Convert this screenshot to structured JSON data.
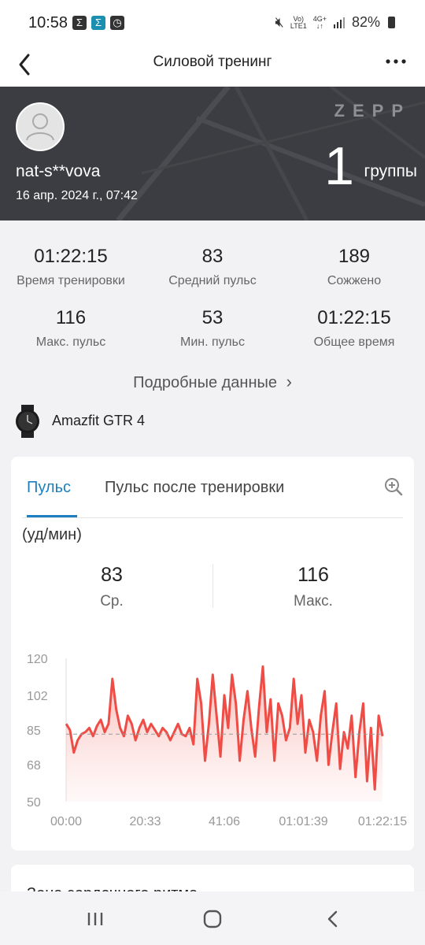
{
  "status_bar": {
    "time": "10:58",
    "battery": "82%",
    "network_top": "Vo)",
    "network_bottom": "LTE1",
    "net4g_top": "4G+",
    "net4g_bottom": "↓↑"
  },
  "app_bar": {
    "title": "Силовой тренинг"
  },
  "banner": {
    "username": "nat-s**vova",
    "datetime": "16 апр. 2024 г., 07:42",
    "brand": "ZEPP",
    "sets_value": "1",
    "sets_label": "группы"
  },
  "stats": [
    {
      "value": "01:22:15",
      "label": "Время тренировки"
    },
    {
      "value": "83",
      "label": "Средний пульс"
    },
    {
      "value": "189",
      "label": "Сожжено"
    },
    {
      "value": "116",
      "label": "Макс. пульс"
    },
    {
      "value": "53",
      "label": "Мин. пульс"
    },
    {
      "value": "01:22:15",
      "label": "Общее время"
    }
  ],
  "details_link": "Подробные данные",
  "device": {
    "name": "Amazfit GTR 4"
  },
  "hr_card": {
    "tabs": [
      "Пульс",
      "Пульс после тренировки"
    ],
    "unit": "(уд/мин)",
    "avg_value": "83",
    "avg_label": "Ср.",
    "max_value": "116",
    "max_label": "Макс."
  },
  "next_card": {
    "title": "Зона сердечного ритма"
  },
  "colors": {
    "accent": "#1c7fc2",
    "line": "#ee4c45",
    "banner": "#3b3d42"
  },
  "chart_data": {
    "type": "area",
    "x_ticks": [
      "00:00",
      "20:33",
      "41:06",
      "01:01:39",
      "01:22:15"
    ],
    "y_ticks": [
      120,
      102,
      85,
      68,
      50
    ],
    "ylim": [
      50,
      120
    ],
    "average": 83,
    "x_minutes": [
      0,
      1,
      2,
      3,
      4,
      5,
      6,
      7,
      8,
      9,
      10,
      11,
      12,
      13,
      14,
      15,
      16,
      17,
      18,
      19,
      20,
      21,
      22,
      23,
      24,
      25,
      26,
      27,
      28,
      29,
      30,
      31,
      32,
      33,
      34,
      35,
      36,
      37,
      38,
      39,
      40,
      41,
      42,
      43,
      44,
      45,
      46,
      47,
      48,
      49,
      50,
      51,
      52,
      53,
      54,
      55,
      56,
      57,
      58,
      59,
      60,
      61,
      62,
      63,
      64,
      65,
      66,
      67,
      68,
      69,
      70,
      71,
      72,
      73,
      74,
      75,
      76,
      77,
      78,
      79,
      80,
      81,
      82
    ],
    "values": [
      88,
      85,
      74,
      80,
      83,
      84,
      86,
      82,
      87,
      90,
      84,
      88,
      110,
      95,
      86,
      82,
      92,
      88,
      80,
      86,
      90,
      84,
      88,
      85,
      82,
      86,
      84,
      80,
      84,
      88,
      83,
      82,
      86,
      78,
      110,
      98,
      70,
      88,
      112,
      92,
      72,
      102,
      86,
      112,
      98,
      70,
      90,
      104,
      86,
      72,
      96,
      116,
      84,
      100,
      70,
      98,
      92,
      80,
      86,
      110,
      88,
      102,
      74,
      90,
      84,
      70,
      92,
      104,
      68,
      84,
      98,
      66,
      84,
      76,
      92,
      62,
      84,
      98,
      60,
      86,
      56,
      92,
      82
    ],
    "grid": false
  }
}
